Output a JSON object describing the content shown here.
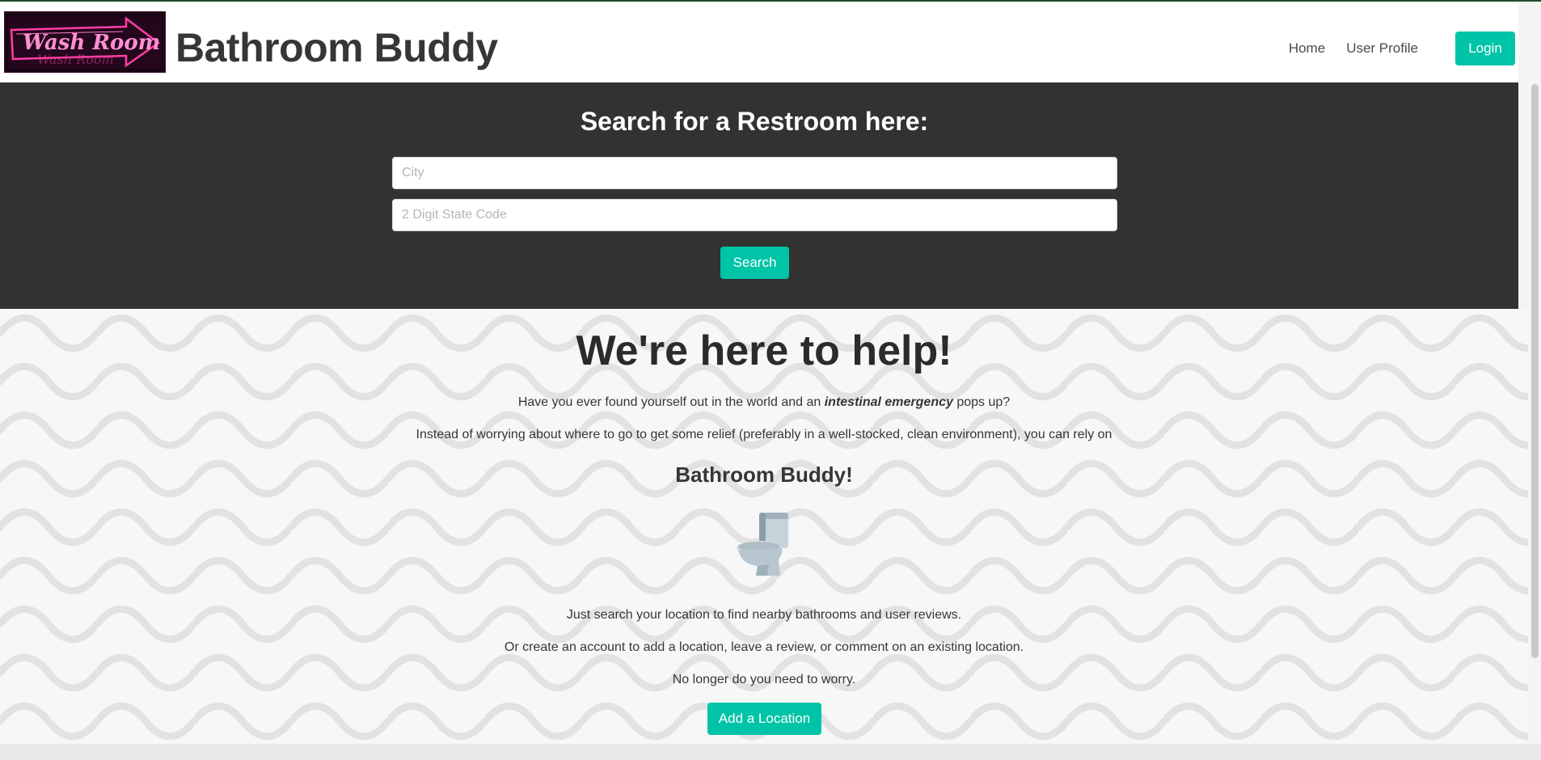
{
  "colors": {
    "accent": "#00c4a7",
    "hero_bg": "#323232",
    "logo_neon": "#ff3ea5"
  },
  "header": {
    "logo_text": "Wash Room",
    "brand": "Bathroom Buddy",
    "nav": {
      "home": "Home",
      "profile": "User Profile",
      "login": "Login"
    }
  },
  "search": {
    "title": "Search for a Restroom here:",
    "city_placeholder": "City",
    "state_placeholder": "2 Digit State Code",
    "button": "Search"
  },
  "intro": {
    "title": "We're here to help!",
    "line1_before": "Have you ever found yourself out in the world and an ",
    "line1_emphasis": "intestinal emergency",
    "line1_after": " pops up?",
    "line2": "Instead of worrying about where to go to get some relief (preferably in a well-stocked, clean environment), you can rely on",
    "brand_callout": "Bathroom Buddy!",
    "icon": "toilet-icon",
    "line3": "Just search your location to find nearby bathrooms and user reviews.",
    "line4": "Or create an account to add a location, leave a review, or comment on an existing location.",
    "line5": "No longer do you need to worry.",
    "add_button": "Add a Location"
  }
}
